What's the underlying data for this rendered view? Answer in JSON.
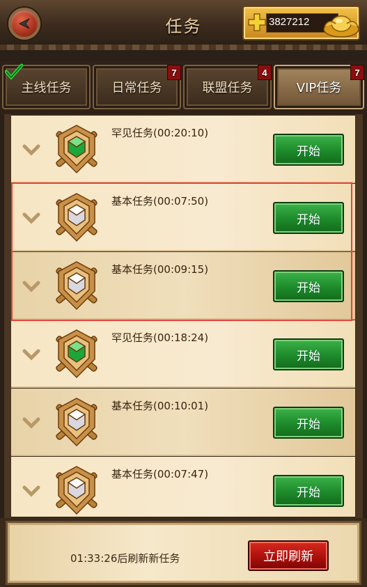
{
  "header": {
    "title": "任务",
    "gold": "3827212"
  },
  "tabs": [
    {
      "label": "主线任务",
      "badge": "",
      "completed": true
    },
    {
      "label": "日常任务",
      "badge": "7"
    },
    {
      "label": "联盟任务",
      "badge": "4"
    },
    {
      "label": "VIP任务",
      "badge": "7",
      "active": true
    }
  ],
  "tasks": [
    {
      "name": "罕见任务(00:20:10)",
      "rarity": "rare",
      "button": "开始"
    },
    {
      "name": "基本任务(00:07:50)",
      "rarity": "basic",
      "button": "开始"
    },
    {
      "name": "基本任务(00:09:15)",
      "rarity": "basic",
      "button": "开始"
    },
    {
      "name": "罕见任务(00:18:24)",
      "rarity": "rare",
      "button": "开始"
    },
    {
      "name": "基本任务(00:10:01)",
      "rarity": "basic",
      "button": "开始"
    },
    {
      "name": "基本任务(00:07:47)",
      "rarity": "basic",
      "button": "开始"
    }
  ],
  "footer": {
    "refresh_text": "01:33:26后刷新新任务",
    "refresh_button": "立即刷新"
  },
  "colors": {
    "start_button": "#1d8a2a",
    "refresh_button": "#a80e0a",
    "highlight_border": "#e8423a",
    "rare_gem": "#1aa83a",
    "basic_gem": "#e8e8ee"
  }
}
